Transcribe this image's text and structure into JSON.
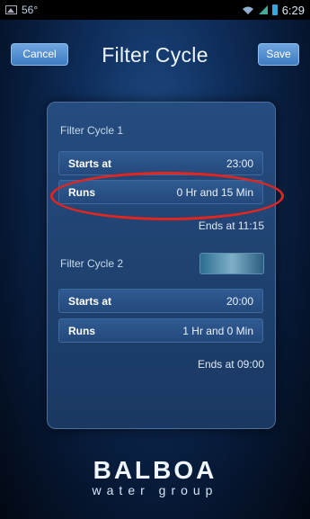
{
  "status_bar": {
    "temperature": "56°",
    "time": "6:29"
  },
  "header": {
    "title": "Filter Cycle",
    "cancel_label": "Cancel",
    "save_label": "Save"
  },
  "filter_cycles": [
    {
      "title": "Filter Cycle 1",
      "starts_label": "Starts at",
      "starts_value": "23:00",
      "runs_label": "Runs",
      "runs_value": "0 Hr and 15 Min",
      "ends_text": "Ends at 11:15"
    },
    {
      "title": "Filter Cycle 2",
      "starts_label": "Starts at",
      "starts_value": "20:00",
      "runs_label": "Runs",
      "runs_value": "1 Hr and 0 Min",
      "ends_text": "Ends at 09:00"
    }
  ],
  "logo": {
    "name": "BALBOA",
    "tagline": "water group"
  },
  "colors": {
    "highlight": "#e0261f",
    "button": "#4f8bd0"
  }
}
